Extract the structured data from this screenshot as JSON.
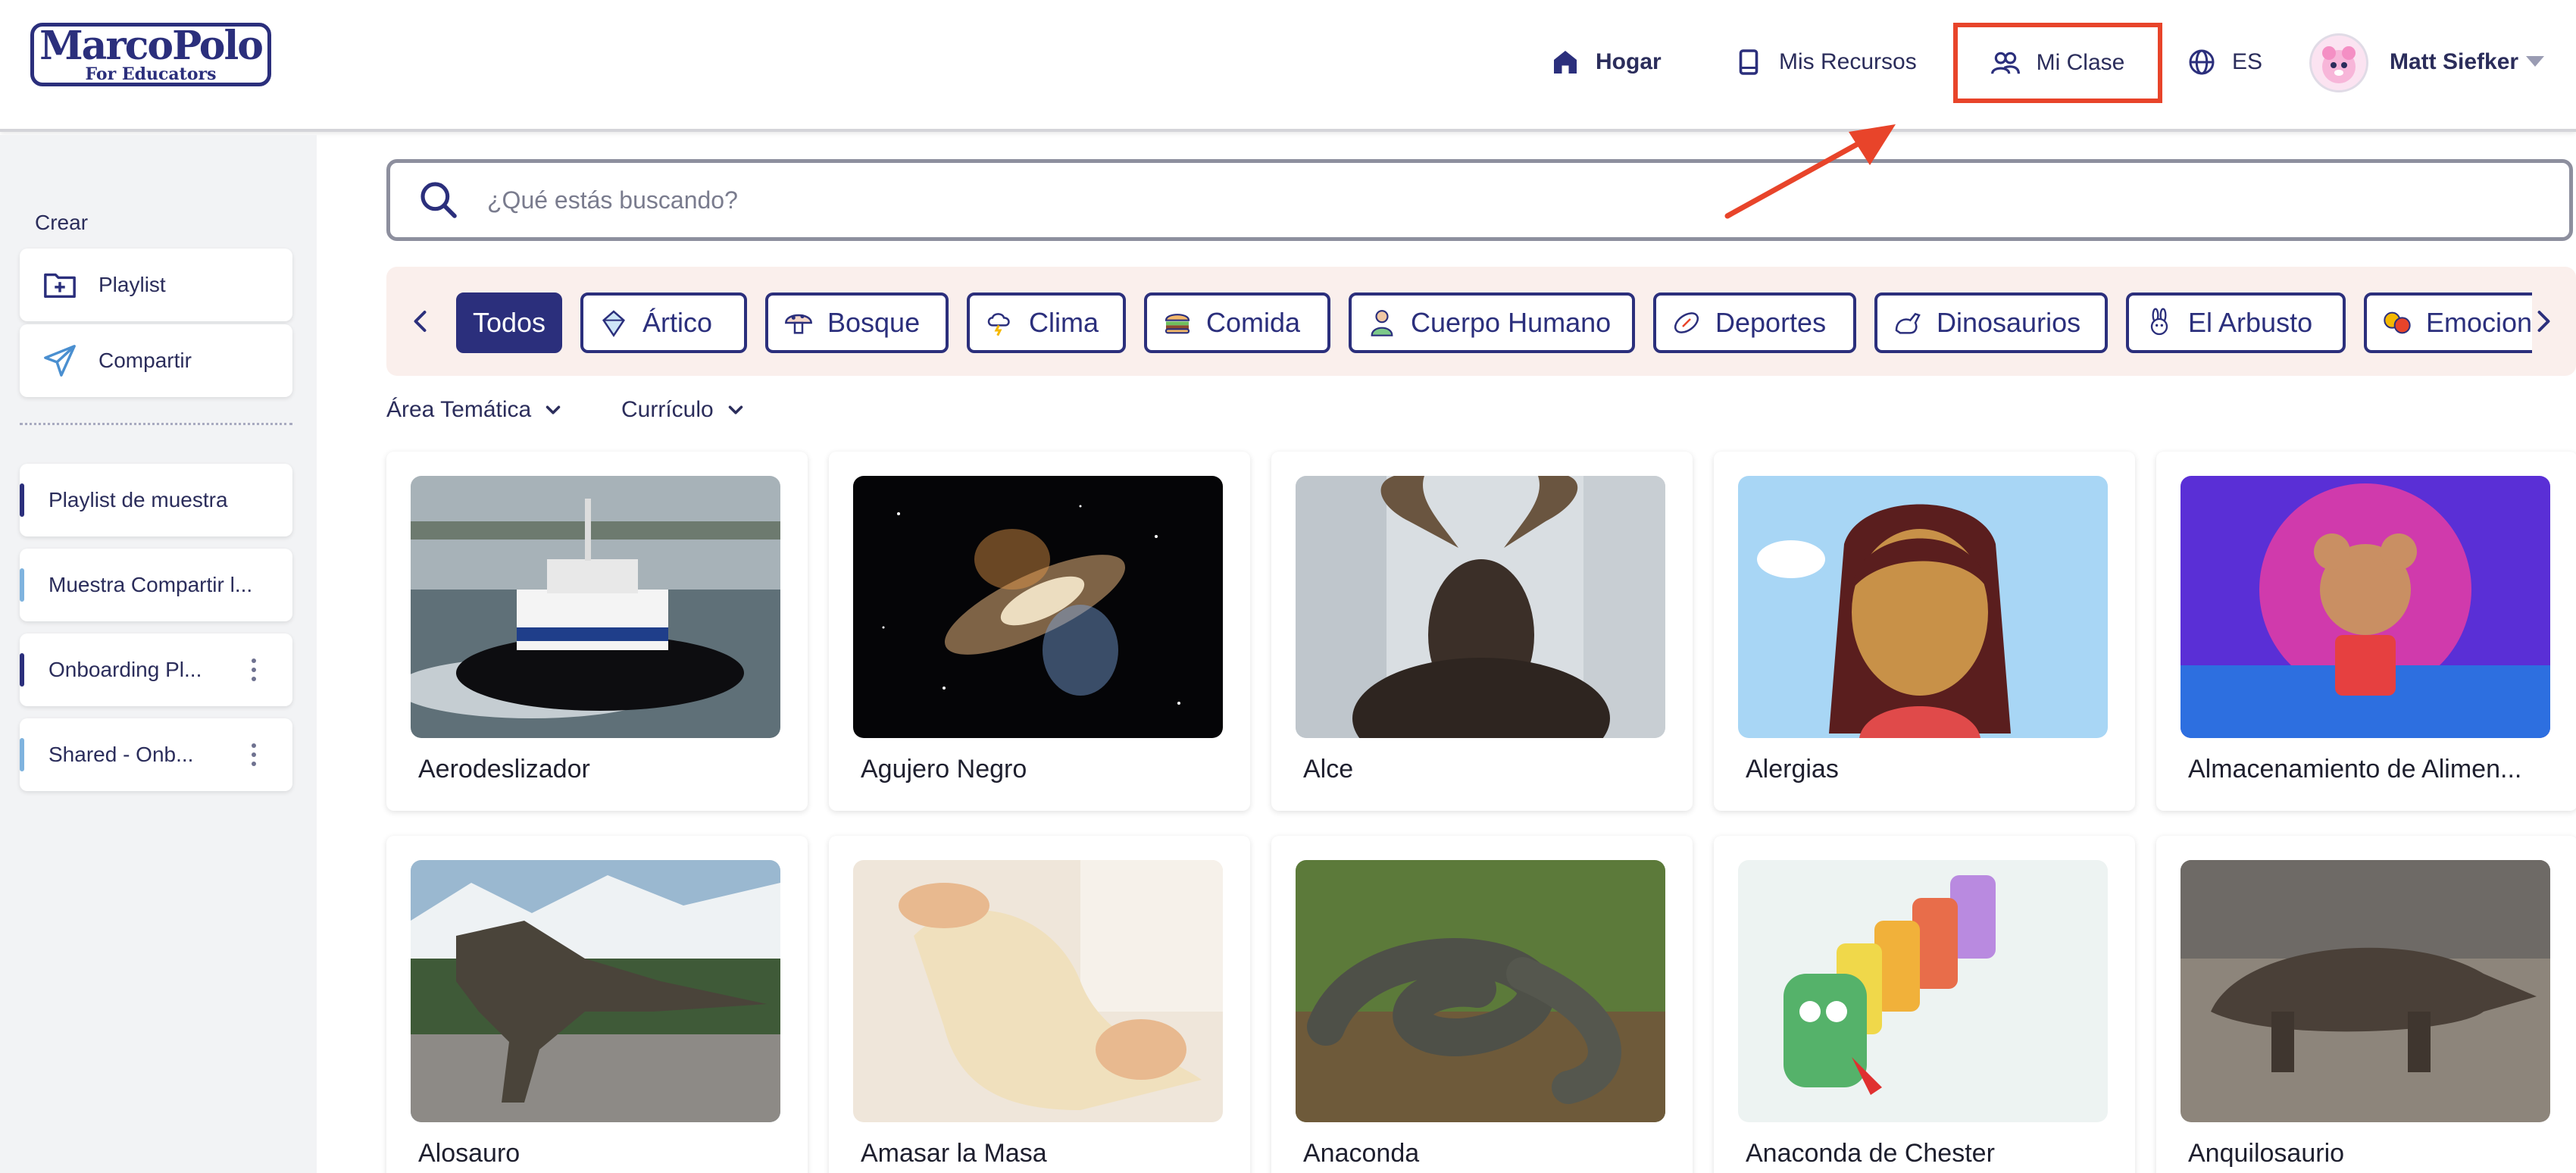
{
  "header": {
    "logo_title": "MarcoPolo",
    "logo_subtitle": "For Educators",
    "nav": {
      "home": "Hogar",
      "resources": "Mis Recursos",
      "class": "Mi Clase",
      "language": "ES"
    },
    "user_name": "Matt Siefker"
  },
  "sidebar": {
    "create_label": "Crear",
    "create_items": [
      "Playlist",
      "Compartir"
    ],
    "playlists": [
      {
        "label": "Playlist de muestra",
        "color": "#2b2f7c"
      },
      {
        "label": "Muestra Compartir l...",
        "color": "#7fb3de"
      },
      {
        "label": "Onboarding Pl...",
        "color": "#2b2f7c"
      },
      {
        "label": "Shared - Onb...",
        "color": "#7fb3de"
      }
    ]
  },
  "search": {
    "placeholder": "¿Qué estás buscando?"
  },
  "categories": [
    "Todos",
    "Ártico",
    "Bosque",
    "Clima",
    "Comida",
    "Cuerpo Humano",
    "Deportes",
    "Dinosaurios",
    "El Arbusto",
    "Emociones"
  ],
  "filters": [
    "Área Temática",
    "Currículo"
  ],
  "topics": [
    "Aerodeslizador",
    "Agujero Negro",
    "Alce",
    "Alergias",
    "Almacenamiento de Alimen...",
    "Alosauro",
    "Amasar la Masa",
    "Anaconda",
    "Anaconda de Chester",
    "Anquilosaurio"
  ],
  "colors": {
    "brand": "#2b2f7c",
    "highlight": "#e8442a",
    "category_strip": "#faefec"
  }
}
